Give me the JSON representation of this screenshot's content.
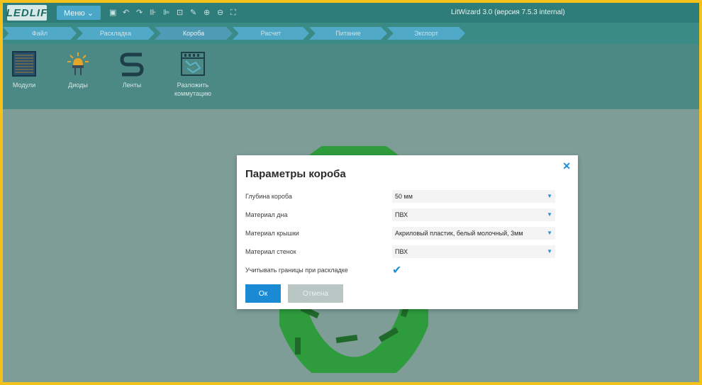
{
  "app": {
    "logo_text": "LEDLIF",
    "menu_label": "Меню ⌄",
    "window_title": "LitWizard 3.0 (версия 7.5.3 internal)"
  },
  "steps": [
    "Файл",
    "Раскладка",
    "Короба",
    "Расчет",
    "Питание",
    "Экспорт"
  ],
  "active_step": "Короба",
  "ribbon": {
    "modules": "Модули",
    "diodes": "Диоды",
    "strips": "Ленты",
    "layout_line1": "Разложить",
    "layout_line2": "коммутацию"
  },
  "dialog": {
    "title": "Параметры короба",
    "close": "✕",
    "rows": [
      {
        "label": "Глубина короба",
        "value": "50 мм"
      },
      {
        "label": "Материал дна",
        "value": "ПВХ"
      },
      {
        "label": "Материал крышки",
        "value": "Акриловый пластик, белый молочный, 3мм"
      },
      {
        "label": "Материал стенок",
        "value": "ПВХ"
      }
    ],
    "checkbox_label": "Учитывать границы при раскладке",
    "checkbox_mark": "✔",
    "ok": "Ок",
    "cancel": "Отмена"
  },
  "colors": {
    "frame": "#f5c21b",
    "accent": "#1a8ad4",
    "ring": "#2e9b3d"
  }
}
